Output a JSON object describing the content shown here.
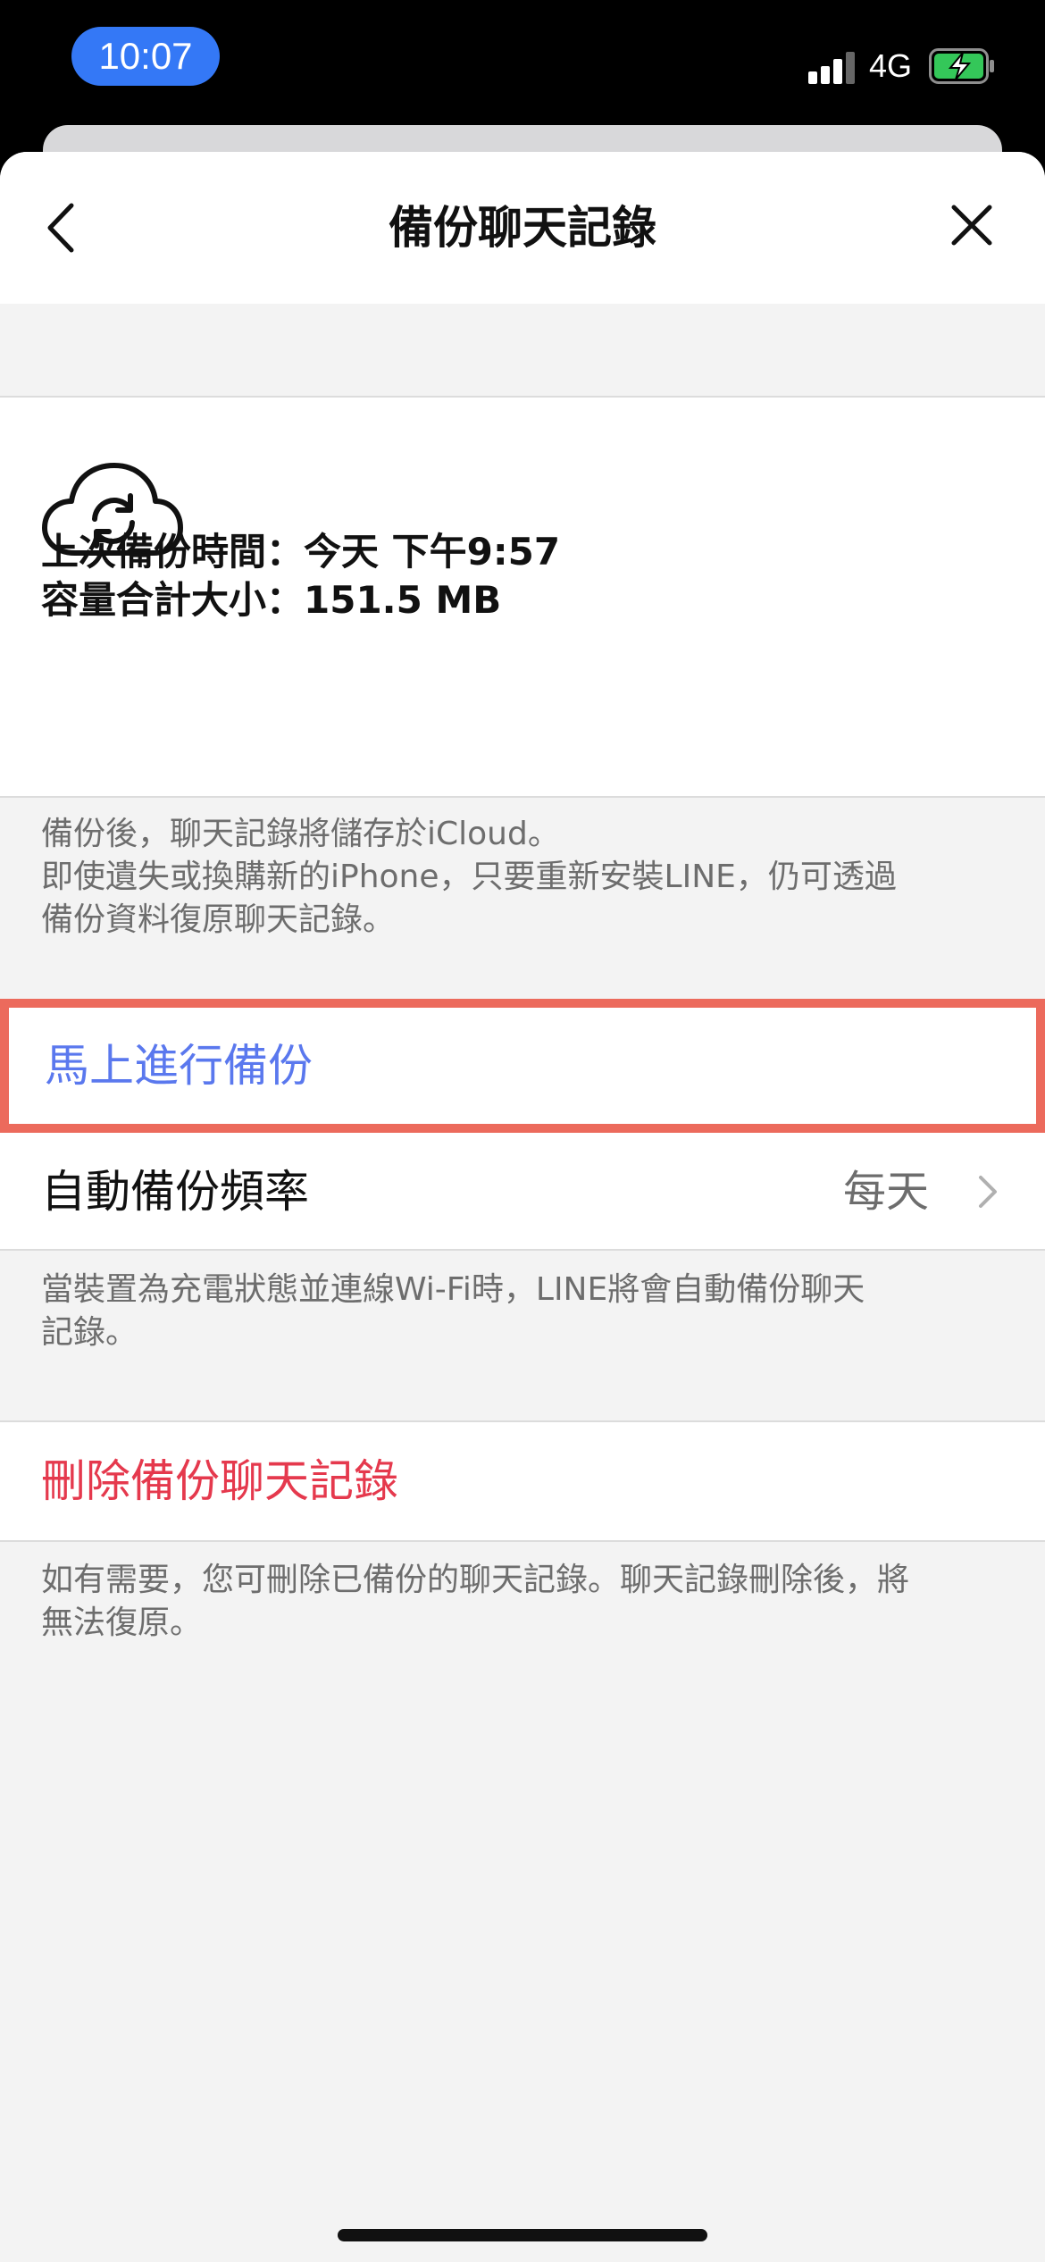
{
  "status_bar": {
    "time": "10:07",
    "network": "4G",
    "battery_color": "#34c759",
    "accent": "#3478f6"
  },
  "nav": {
    "title": "備份聊天記錄",
    "back_icon": "chevron-left-icon",
    "close_icon": "close-icon"
  },
  "backup_info": {
    "icon": "cloud-sync-icon",
    "last_backup": "上次備份時間：今天 下午9:57",
    "total_size": "容量合計大小：151.5 MB"
  },
  "backup_note": {
    "lines": [
      "備份後，聊天記錄將儲存於iCloud。",
      "即使遺失或換購新的iPhone，只要重新安裝LINE，仍可透過",
      "備份資料復原聊天記錄。"
    ]
  },
  "actions": {
    "backup_now": "馬上進行備份",
    "backup_now_color": "#5a78ee",
    "highlight_color": "#ec6a5c",
    "auto_frequency_label": "自動備份頻率",
    "auto_frequency_value": "每天",
    "delete_backup": "刪除備份聊天記錄",
    "delete_color": "#e5394d"
  },
  "auto_note": {
    "lines": [
      "當裝置為充電狀態並連線Wi-Fi時，LINE將會自動備份聊天",
      "記錄。"
    ]
  },
  "delete_note": {
    "lines": [
      "如有需要，您可刪除已備份的聊天記錄。聊天記錄刪除後，將",
      "無法復原。"
    ]
  }
}
